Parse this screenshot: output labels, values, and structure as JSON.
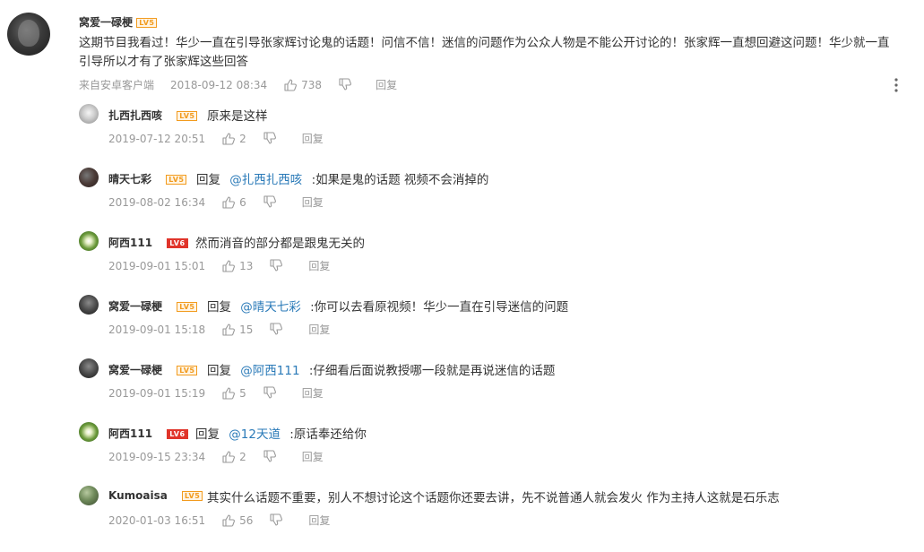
{
  "main": {
    "user": "窝爱一碌梗",
    "level": "LV5",
    "text": "这期节目我看过！华少一直在引导张家辉讨论鬼的话题！问信不信！迷信的问题作为公众人物是不能公开讨论的！张家辉一直想回避这问题！华少就一直引导所以才有了张家辉这些回答",
    "source": "来自安卓客户端",
    "time": "2018-09-12 08:34",
    "likes": "738",
    "reply_label": "回复"
  },
  "replies": [
    {
      "user": "扎西扎西咳",
      "level": "LV5",
      "reply_prefix": "",
      "mention": "",
      "text": "原来是这样",
      "time": "2019-07-12 20:51",
      "likes": "2",
      "reply_label": "回复"
    },
    {
      "user": "晴天七彩",
      "level": "LV5",
      "reply_prefix": "回复",
      "mention": "@扎西扎西咳",
      "text": ":如果是鬼的话题 视频不会消掉的",
      "time": "2019-08-02 16:34",
      "likes": "6",
      "reply_label": "回复"
    },
    {
      "user": "阿西111",
      "level": "LV6",
      "reply_prefix": "",
      "mention": "",
      "text": "然而消音的部分都是跟鬼无关的",
      "time": "2019-09-01 15:01",
      "likes": "13",
      "reply_label": "回复"
    },
    {
      "user": "窝爱一碌梗",
      "level": "LV5",
      "reply_prefix": "回复",
      "mention": "@晴天七彩",
      "text": ":你可以去看原视频！华少一直在引导迷信的问题",
      "time": "2019-09-01 15:18",
      "likes": "15",
      "reply_label": "回复"
    },
    {
      "user": "窝爱一碌梗",
      "level": "LV5",
      "reply_prefix": "回复",
      "mention": "@阿西111",
      "text": ":仔细看后面说教授哪一段就是再说迷信的话题",
      "time": "2019-09-01 15:19",
      "likes": "5",
      "reply_label": "回复"
    },
    {
      "user": "阿西111",
      "level": "LV6",
      "reply_prefix": "回复",
      "mention": "@12天道",
      "text": ":原话奉还给你",
      "time": "2019-09-15 23:34",
      "likes": "2",
      "reply_label": "回复"
    },
    {
      "user": "Kumoaisa",
      "level": "LV5",
      "reply_prefix": "",
      "mention": "",
      "text": "其实什么话题不重要，别人不想讨论这个话题你还要去讲，先不说普通人就会发火 作为主持人这就是石乐志",
      "time": "2020-01-03 16:51",
      "likes": "56",
      "reply_label": "回复"
    }
  ],
  "icons": {
    "like": "thumbs-up-icon",
    "dislike": "thumbs-down-icon",
    "more": "more-vertical-icon"
  },
  "colors": {
    "mention": "#2a7ab8",
    "meta": "#999999",
    "level_orange": "#f29b1e",
    "level_red": "#e0342a"
  }
}
